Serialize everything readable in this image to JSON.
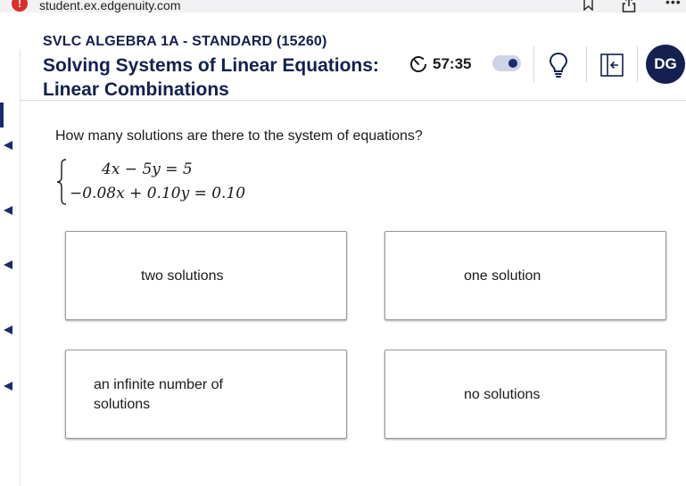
{
  "browser": {
    "url": "student.ex.edgenuity.com",
    "warning_glyph": "!",
    "more_glyph": "•••"
  },
  "header": {
    "course_title": "SVLC ALGEBRA 1A - STANDARD (15260)",
    "lesson_title": "Solving Systems of Linear Equations: Linear Combinations",
    "timer": "57:35",
    "avatar_initials": "DG",
    "accent_color": "#14204f"
  },
  "question": {
    "prompt": "How many solutions are there to the system of equations?",
    "equations": [
      "4x − 5y = 5",
      "−0.08x + 0.10y = 0.10"
    ]
  },
  "choices": [
    "two solutions",
    "one solution",
    "an infinite number of solutions",
    "no solutions"
  ]
}
